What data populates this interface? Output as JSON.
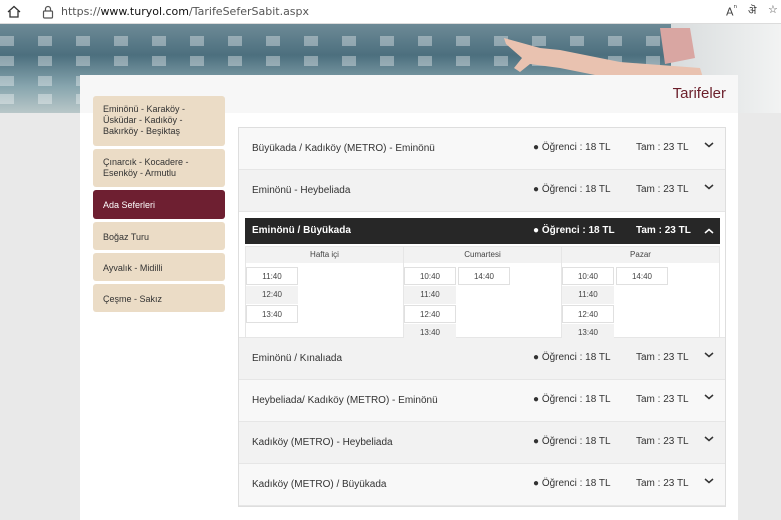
{
  "browser": {
    "url_prefix": "https://",
    "url_host": "www.turyol.com",
    "url_path": "/TarifeSeferSabit.aspx",
    "icons": [
      "home-icon",
      "lock-icon",
      "read-aloud-icon",
      "translate-icon",
      "favorite-icon"
    ]
  },
  "page": {
    "title": "Tarifeler"
  },
  "sidebar": {
    "items": [
      {
        "label": "Eminönü - Karaköy - Üsküdar - Kadıköy - Bakırköy - Beşiktaş"
      },
      {
        "label": "Çınarcık - Kocadere - Esenköy - Armutlu"
      },
      {
        "label": "Ada Seferleri"
      },
      {
        "label": "Boğaz Turu"
      },
      {
        "label": "Ayvalık - Midilli"
      },
      {
        "label": "Çeşme - Sakız"
      }
    ]
  },
  "routes": [
    {
      "name": "Büyükada / Kadıköy (METRO) - Eminönü",
      "student": "● Öğrenci : 18 TL",
      "full": "Tam : 23 TL"
    },
    {
      "name": "Eminönü - Heybeliada",
      "student": "● Öğrenci : 18 TL",
      "full": "Tam : 23 TL"
    },
    {
      "name": "Eminönü / Büyükada",
      "student": "● Öğrenci : 18 TL",
      "full": "Tam : 23 TL"
    },
    {
      "name": "Eminönü / Kınalıada",
      "student": "● Öğrenci : 18 TL",
      "full": "Tam : 23 TL"
    },
    {
      "name": "Heybeliada/ Kadıköy (METRO) - Eminönü",
      "student": "● Öğrenci : 18 TL",
      "full": "Tam : 23 TL"
    },
    {
      "name": "Kadıköy (METRO) - Heybeliada",
      "student": "● Öğrenci : 18 TL",
      "full": "Tam : 23 TL"
    },
    {
      "name": "Kadıköy (METRO) / Büyükada",
      "student": "● Öğrenci : 18 TL",
      "full": "Tam : 23 TL"
    }
  ],
  "schedule": {
    "weekday": {
      "label": "Hafta içi",
      "times": [
        "11:40",
        "12:40",
        "13:40"
      ]
    },
    "saturday": {
      "label": "Cumartesi",
      "times": [
        "10:40",
        "11:40",
        "12:40",
        "13:40"
      ],
      "extra": [
        "14:40"
      ]
    },
    "sunday": {
      "label": "Pazar",
      "times": [
        "10:40",
        "11:40",
        "12:40",
        "13:40"
      ],
      "extra": [
        "14:40"
      ]
    }
  },
  "colors": {
    "active_menu": "#6e1f31",
    "menu_bg": "#ebdcc6",
    "title": "#6b1e2a"
  }
}
